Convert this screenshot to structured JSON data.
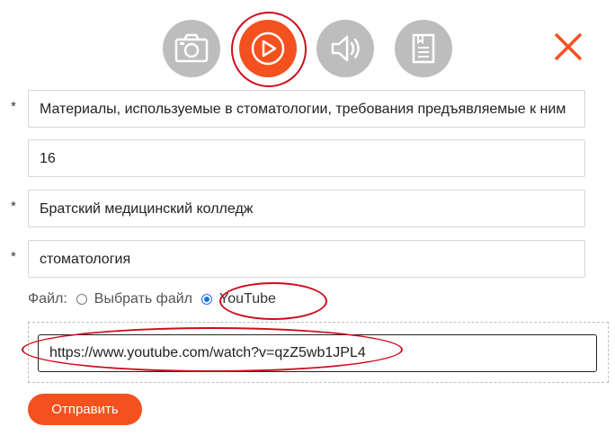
{
  "media_types": [
    {
      "name": "photo",
      "icon": "camera-icon",
      "active": false
    },
    {
      "name": "video",
      "icon": "play-icon",
      "active": true
    },
    {
      "name": "audio",
      "icon": "speaker-icon",
      "active": false
    },
    {
      "name": "document",
      "icon": "document-icon",
      "active": false
    }
  ],
  "colors": {
    "accent": "#f5511e",
    "inactive": "#bdbdbd",
    "highlight": "#cc0e1e",
    "radio": "#1a73e8"
  },
  "form": {
    "required_mark": "*",
    "title": "Материалы, используемые в стоматологии, требования предъявляемые к ним",
    "number": "16",
    "institution": "Братский медицинский колледж",
    "specialty": "стоматология",
    "file_label": "Файл:",
    "file_option_upload": "Выбрать файл",
    "file_option_youtube": "YouTube",
    "file_selected": "YouTube",
    "youtube_url": "https://www.youtube.com/watch?v=qzZ5wb1JPL4",
    "submit_label": "Отправить"
  }
}
